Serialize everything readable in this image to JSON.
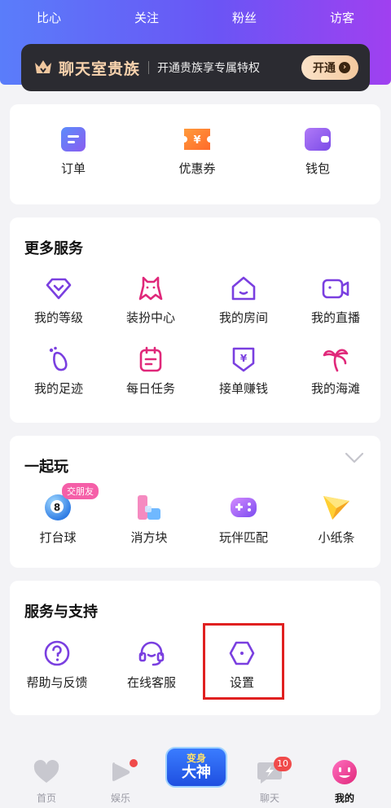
{
  "header": {
    "stats": [
      "比心",
      "关注",
      "粉丝",
      "访客"
    ],
    "vip": {
      "title": "聊天室贵族",
      "desc": "开通贵族享专属特权",
      "button": "开通"
    }
  },
  "quick": [
    {
      "label": "订单",
      "icon": "order-icon"
    },
    {
      "label": "优惠券",
      "icon": "coupon-icon"
    },
    {
      "label": "钱包",
      "icon": "wallet-icon"
    }
  ],
  "more_services": {
    "title": "更多服务",
    "items": [
      {
        "label": "我的等级",
        "icon": "level-icon"
      },
      {
        "label": "装扮中心",
        "icon": "dressup-icon"
      },
      {
        "label": "我的房间",
        "icon": "room-icon"
      },
      {
        "label": "我的直播",
        "icon": "live-icon"
      },
      {
        "label": "我的足迹",
        "icon": "footprint-icon"
      },
      {
        "label": "每日任务",
        "icon": "task-icon"
      },
      {
        "label": "接单赚钱",
        "icon": "earn-icon"
      },
      {
        "label": "我的海滩",
        "icon": "beach-icon"
      }
    ]
  },
  "play_together": {
    "title": "一起玩",
    "badge": "交朋友",
    "items": [
      {
        "label": "打台球",
        "icon": "billiards-icon"
      },
      {
        "label": "消方块",
        "icon": "blocks-icon"
      },
      {
        "label": "玩伴匹配",
        "icon": "gamepad-icon"
      },
      {
        "label": "小纸条",
        "icon": "paper-plane-icon"
      }
    ]
  },
  "support": {
    "title": "服务与支持",
    "items": [
      {
        "label": "帮助与反馈",
        "icon": "help-icon"
      },
      {
        "label": "在线客服",
        "icon": "headset-icon"
      },
      {
        "label": "设置",
        "icon": "settings-icon"
      }
    ]
  },
  "nav": {
    "items": [
      {
        "label": "首页",
        "icon": "heart-icon"
      },
      {
        "label": "娱乐",
        "icon": "play-icon"
      },
      {
        "label": "聊天",
        "icon": "chat-icon",
        "badge": "10"
      },
      {
        "label": "我的",
        "icon": "face-icon"
      }
    ],
    "promo_line1": "变身",
    "promo_line2": "大神"
  },
  "colors": {
    "accent_purple": "#7a3fe0",
    "accent_pink": "#e0287a",
    "header_start": "#5a7dfa",
    "header_end": "#a040f0",
    "highlight_red": "#e02020"
  }
}
